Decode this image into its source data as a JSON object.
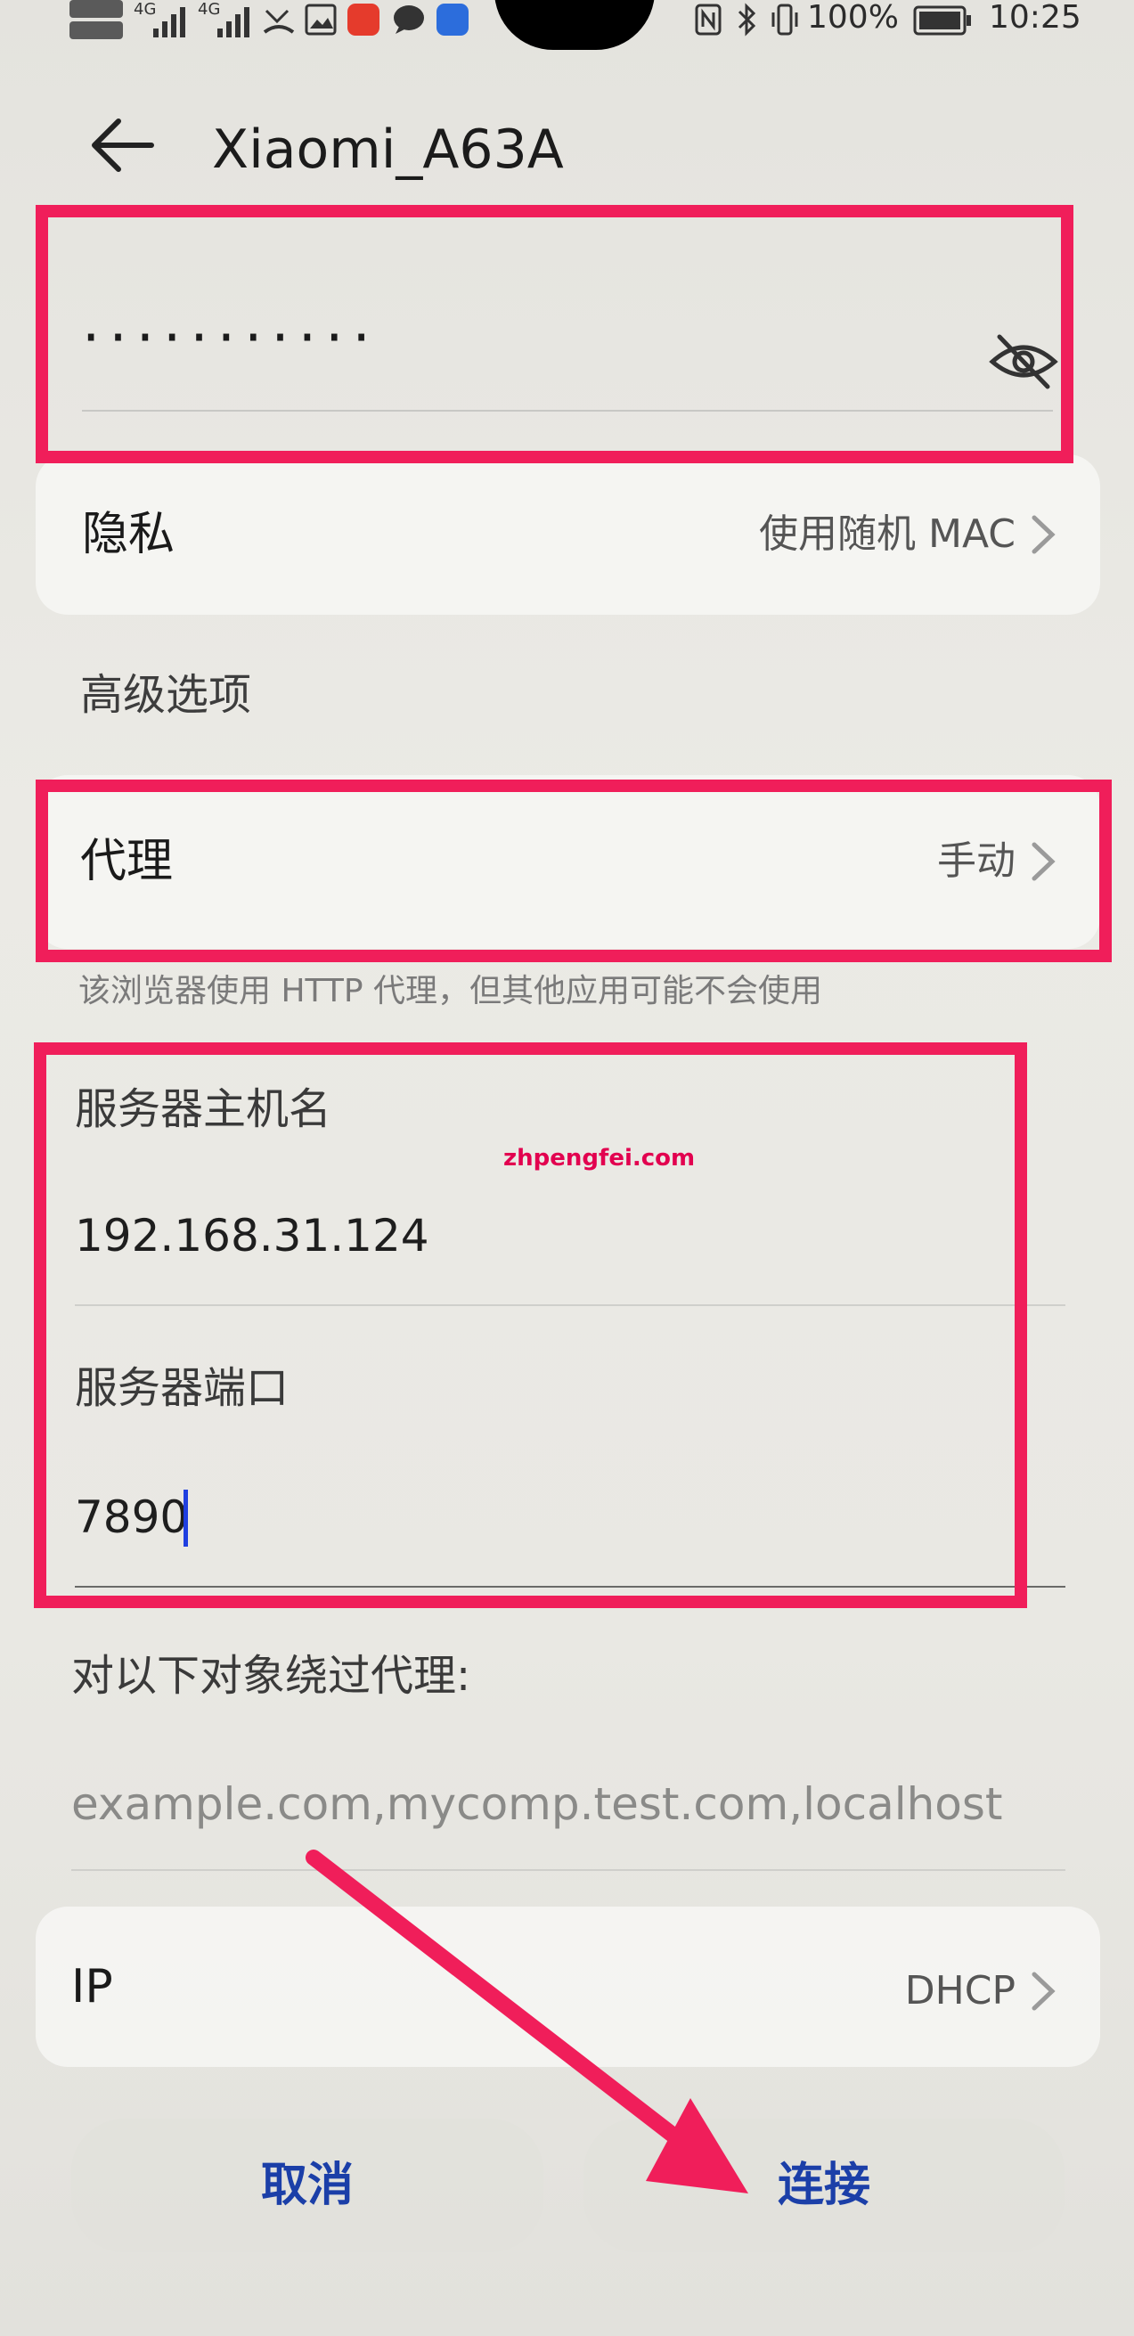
{
  "status_bar": {
    "net1": "4G",
    "net2": "4G",
    "battery": "100%",
    "time": "10:25",
    "icons": [
      "hd-icon",
      "signal-icon",
      "signal-icon",
      "missed-call-icon",
      "gallery-icon",
      "huawei-app-icon",
      "chat-icon",
      "cloud-icon",
      "nfc-icon",
      "bluetooth-icon",
      "vibrate-icon",
      "battery-icon"
    ]
  },
  "header": {
    "title": "Xiaomi_A63A",
    "back_icon": "arrow-left-icon"
  },
  "password": {
    "masked": "···········",
    "toggle_icon": "eye-off-icon"
  },
  "privacy": {
    "label": "隐私",
    "value": "使用随机 MAC"
  },
  "advanced": {
    "title": "高级选项"
  },
  "proxy": {
    "label": "代理",
    "value": "手动",
    "note": "该浏览器使用 HTTP 代理，但其他应用可能不会使用"
  },
  "server": {
    "host_label": "服务器主机名",
    "host_value": "192.168.31.124",
    "port_label": "服务器端口",
    "port_value": "7890"
  },
  "bypass": {
    "label": "对以下对象绕过代理:",
    "placeholder": "example.com,mycomp.test.com,localhost"
  },
  "ip": {
    "label": "IP",
    "value": "DHCP"
  },
  "buttons": {
    "cancel": "取消",
    "connect": "连接"
  },
  "watermark": "zhpengfei.com",
  "colors": {
    "highlight": "#f01e5a",
    "button_text": "#1b3fa8",
    "cursor": "#1f3fe0"
  }
}
